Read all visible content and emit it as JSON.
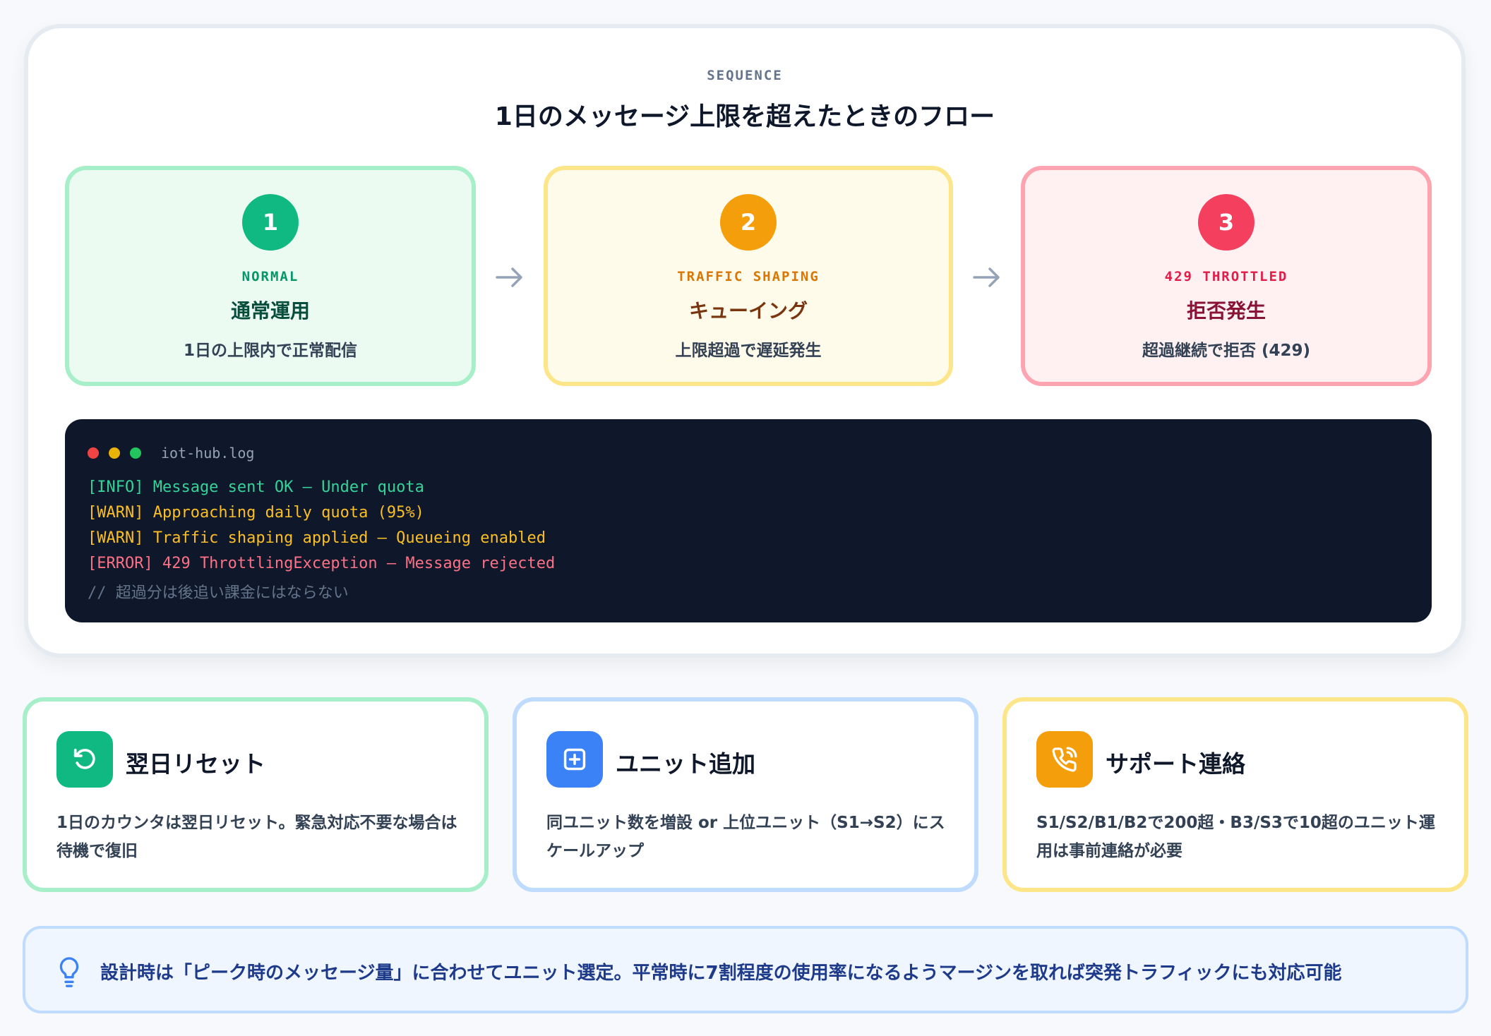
{
  "sequence": {
    "kicker": "SEQUENCE",
    "title": "1日のメッセージ上限を超えたときのフロー",
    "steps": [
      {
        "number": "1",
        "code": "NORMAL",
        "name": "通常運用",
        "desc": "1日の上限内で正常配信",
        "color": "#10b981"
      },
      {
        "number": "2",
        "code": "TRAFFIC SHAPING",
        "name": "キューイング",
        "desc": "上限超過で遅延発生",
        "color": "#f59e0b"
      },
      {
        "number": "3",
        "code": "429 THROTTLED",
        "name": "拒否発生",
        "desc": "超過継続で拒否 (429)",
        "color": "#f43f5e"
      }
    ]
  },
  "log": {
    "title": "iot-hub.log",
    "lines": [
      "[INFO] Message sent OK – Under quota",
      "[WARN] Approaching daily quota (95%)",
      "[WARN] Traffic shaping applied – Queueing enabled",
      "[ERROR] 429 ThrottlingException – Message rejected",
      "// 超過分は後追い課金にはならない"
    ]
  },
  "cards": [
    {
      "icon": "reset-icon",
      "title": "翌日リセット",
      "desc": "1日のカウンタは翌日リセット。緊急対応不要な場合は待機で復旧"
    },
    {
      "icon": "plus-square-icon",
      "title": "ユニット追加",
      "desc": "同ユニット数を増設 or 上位ユニット（S1→S2）にスケールアップ"
    },
    {
      "icon": "phone-icon",
      "title": "サポート連絡",
      "desc": "S1/S2/B1/B2で200超・B3/S3で10超のユニット運用は事前連絡が必要"
    }
  ],
  "tip": {
    "icon": "lightbulb-icon",
    "text": "設計時は「ピーク時のメッセージ量」に合わせてユニット選定。平常時に7割程度の使用率になるようマージンを取れば突発トラフィックにも対応可能"
  }
}
